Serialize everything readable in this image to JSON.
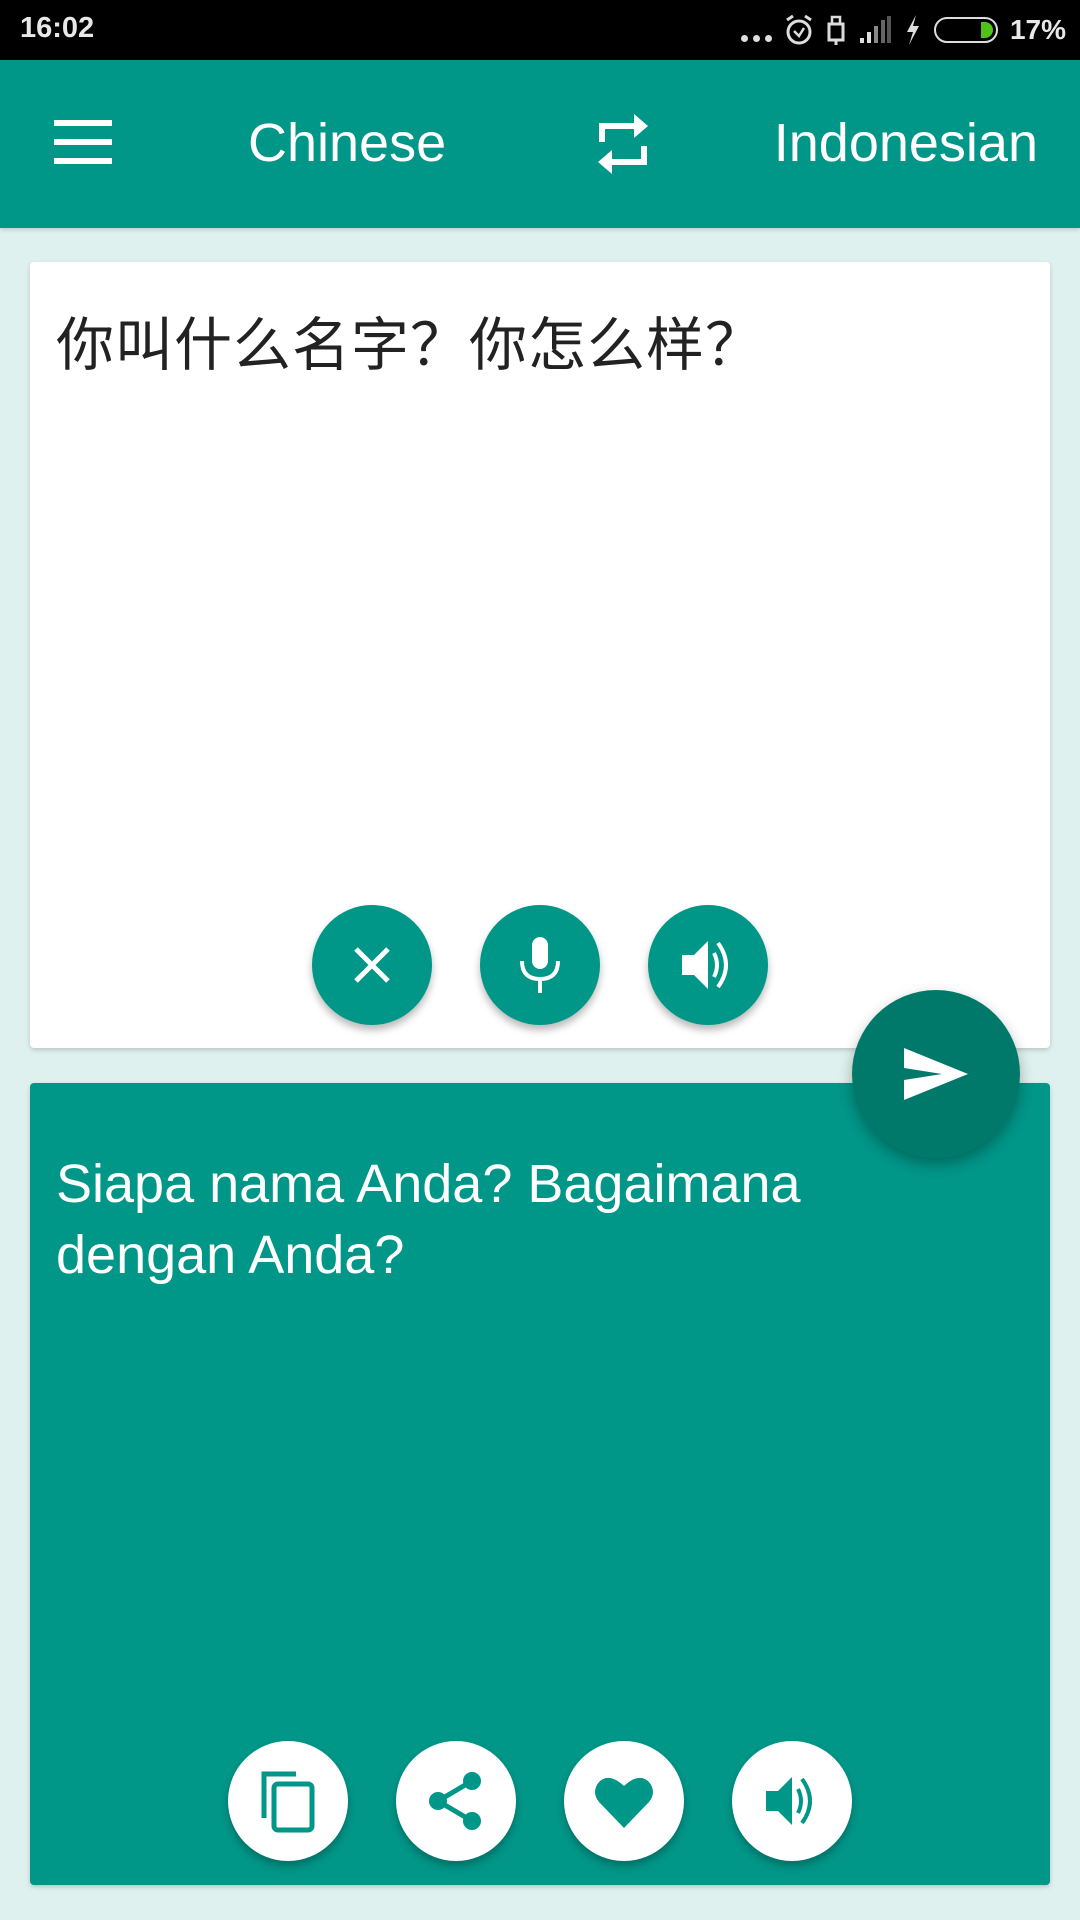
{
  "status_bar": {
    "time": "16:02",
    "battery_percent": "17%",
    "battery_level": 0.17,
    "icons": [
      "more-dots-icon",
      "alarm-icon",
      "usb-icon",
      "signal-icon",
      "charging-icon",
      "battery-icon"
    ]
  },
  "app_bar": {
    "menu_icon": "hamburger-menu-icon",
    "source_language": "Chinese",
    "swap_icon": "swap-languages-icon",
    "target_language": "Indonesian"
  },
  "source": {
    "text": "你叫什么名字？你怎么样？",
    "actions": [
      {
        "name": "clear",
        "icon": "close-icon"
      },
      {
        "name": "voice-input",
        "icon": "microphone-icon"
      },
      {
        "name": "speak-source",
        "icon": "speaker-icon"
      }
    ]
  },
  "translate_button": {
    "icon": "send-icon"
  },
  "target": {
    "text": "Siapa nama Anda? Bagaimana dengan Anda?",
    "actions": [
      {
        "name": "copy",
        "icon": "copy-icon"
      },
      {
        "name": "share",
        "icon": "share-icon"
      },
      {
        "name": "favorite",
        "icon": "heart-icon"
      },
      {
        "name": "speak-target",
        "icon": "speaker-icon"
      }
    ]
  },
  "colors": {
    "primary": "#009688",
    "primary_dark": "#00796b",
    "background": "#dff1ee",
    "card": "#ffffff"
  }
}
